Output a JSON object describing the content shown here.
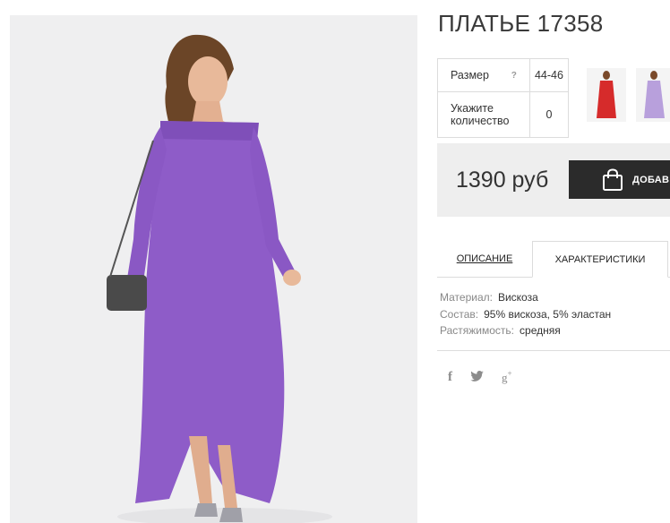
{
  "product": {
    "title": "ПЛАТЬЕ 17358",
    "dress_color": "#8e5cc8"
  },
  "options": {
    "size_label": "Размер",
    "size_help": "?",
    "size_value": "44-46",
    "qty_label_line1": "Укажите",
    "qty_label_line2": "количество",
    "qty_value": "0"
  },
  "thumbnails": [
    {
      "name": "red-dress",
      "color": "#d62b2b"
    },
    {
      "name": "lilac-dress",
      "color": "#b8a0dc"
    }
  ],
  "buy": {
    "price": "1390 руб",
    "cart_label": "ДОБАВИТЬ В КОРЗИНУ",
    "cart_icon": "shopping-bag-icon"
  },
  "tabs": {
    "description": "ОПИСАНИЕ",
    "characteristics": "ХАРАКТЕРИСТИКИ",
    "active": "characteristics"
  },
  "specs": [
    {
      "key": "Материал:",
      "value": "Вискоза"
    },
    {
      "key": "Состав:",
      "value": "95% вискоза, 5% эластан"
    },
    {
      "key": "Растяжимость:",
      "value": "средняя"
    }
  ],
  "social": {
    "facebook": "f",
    "twitter_icon": "twitter-bird-icon",
    "googleplus": "g",
    "googleplus_sup": "+"
  }
}
